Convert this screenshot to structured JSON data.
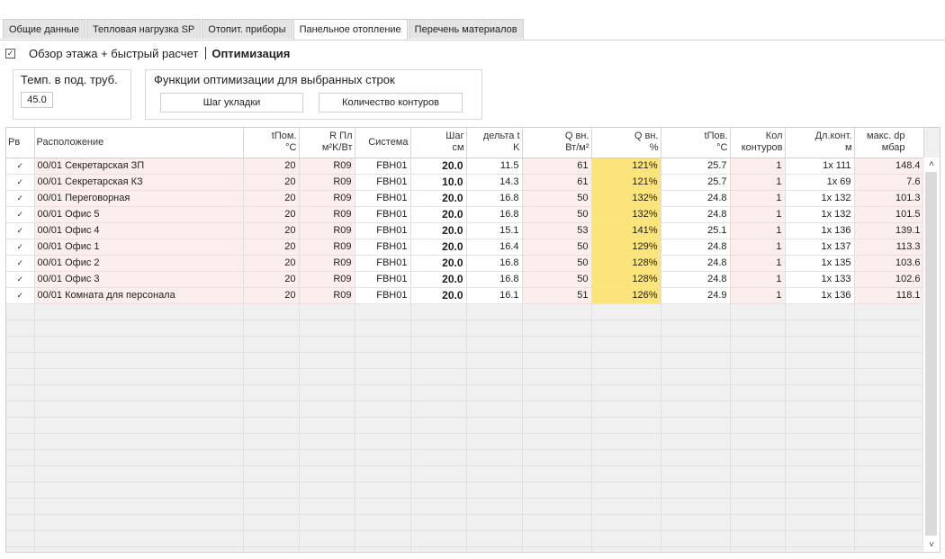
{
  "tabs": [
    {
      "label": "Общие данные",
      "active": false
    },
    {
      "label": "Тепловая нагрузка SP",
      "active": false
    },
    {
      "label": "Отопит. приборы",
      "active": false
    },
    {
      "label": "Панельное отопление",
      "active": true
    },
    {
      "label": "Перечень материалов",
      "active": false
    }
  ],
  "options": {
    "checkbox_checked": true,
    "overview_label": "Обзор этажа + быстрый расчет",
    "section_title": "Оптимизация"
  },
  "temp_group": {
    "title": "Темп. в под. труб.",
    "value": "45.0"
  },
  "opt_group": {
    "title": "Функции оптимизации для выбранных строк",
    "step_button": "Шаг укладки",
    "circuits_button": "Количество контуров"
  },
  "table": {
    "headers": [
      {
        "l1": "Рв",
        "l2": ""
      },
      {
        "l1": "Расположение",
        "l2": ""
      },
      {
        "l1": "tПом.",
        "l2": "°C"
      },
      {
        "l1": "R Пл",
        "l2": "м²K/Вт"
      },
      {
        "l1": "Система",
        "l2": ""
      },
      {
        "l1": "Шаг",
        "l2": "см"
      },
      {
        "l1": "дельта t",
        "l2": "K"
      },
      {
        "l1": "Q вн.",
        "l2": "Вт/м²"
      },
      {
        "l1": "Q вн.",
        "l2": "%"
      },
      {
        "l1": "tПов.",
        "l2": "°C"
      },
      {
        "l1": "Кол",
        "l2": "контуров"
      },
      {
        "l1": "Дл.конт.",
        "l2": "м"
      },
      {
        "l1": "макс. dp",
        "l2": "мбар"
      }
    ],
    "rows": [
      {
        "rv": "✓",
        "loc": "00/01 Секретарская ЗП",
        "t": "20",
        "r": "R09",
        "sys": "FBH01",
        "step": "20.0",
        "dt": "11.5",
        "q": "61",
        "qp": "121%",
        "tp": "25.7",
        "cnt": "1",
        "len": "1x 111",
        "dp": "148.4"
      },
      {
        "rv": "✓",
        "loc": "00/01 Секретарская КЗ",
        "t": "20",
        "r": "R09",
        "sys": "FBH01",
        "step": "10.0",
        "dt": "14.3",
        "q": "61",
        "qp": "121%",
        "tp": "25.7",
        "cnt": "1",
        "len": "1x 69",
        "dp": "7.6"
      },
      {
        "rv": "✓",
        "loc": "00/01 Переговорная",
        "t": "20",
        "r": "R09",
        "sys": "FBH01",
        "step": "20.0",
        "dt": "16.8",
        "q": "50",
        "qp": "132%",
        "tp": "24.8",
        "cnt": "1",
        "len": "1x 132",
        "dp": "101.3"
      },
      {
        "rv": "✓",
        "loc": "00/01 Офис 5",
        "t": "20",
        "r": "R09",
        "sys": "FBH01",
        "step": "20.0",
        "dt": "16.8",
        "q": "50",
        "qp": "132%",
        "tp": "24.8",
        "cnt": "1",
        "len": "1x 132",
        "dp": "101.5"
      },
      {
        "rv": "✓",
        "loc": "00/01 Офис 4",
        "t": "20",
        "r": "R09",
        "sys": "FBH01",
        "step": "20.0",
        "dt": "15.1",
        "q": "53",
        "qp": "141%",
        "tp": "25.1",
        "cnt": "1",
        "len": "1x 136",
        "dp": "139.1"
      },
      {
        "rv": "✓",
        "loc": "00/01 Офис 1",
        "t": "20",
        "r": "R09",
        "sys": "FBH01",
        "step": "20.0",
        "dt": "16.4",
        "q": "50",
        "qp": "129%",
        "tp": "24.8",
        "cnt": "1",
        "len": "1x 137",
        "dp": "113.3"
      },
      {
        "rv": "✓",
        "loc": "00/01 Офис 2",
        "t": "20",
        "r": "R09",
        "sys": "FBH01",
        "step": "20.0",
        "dt": "16.8",
        "q": "50",
        "qp": "128%",
        "tp": "24.8",
        "cnt": "1",
        "len": "1x 135",
        "dp": "103.6"
      },
      {
        "rv": "✓",
        "loc": "00/01 Офис 3",
        "t": "20",
        "r": "R09",
        "sys": "FBH01",
        "step": "20.0",
        "dt": "16.8",
        "q": "50",
        "qp": "128%",
        "tp": "24.8",
        "cnt": "1",
        "len": "1x 133",
        "dp": "102.6"
      },
      {
        "rv": "✓",
        "loc": "00/01 Комната для персонала",
        "t": "20",
        "r": "R09",
        "sys": "FBH01",
        "step": "20.0",
        "dt": "16.1",
        "q": "51",
        "qp": "126%",
        "tp": "24.9",
        "cnt": "1",
        "len": "1x 136",
        "dp": "118.1"
      }
    ]
  },
  "colors": {
    "row_pink": "#fdeeee",
    "highlight_yellow": "#fbe47b"
  },
  "icons": {
    "checkbox": "check-icon",
    "row_marker": "chevron-down-icon",
    "scroll_up": "chevron-up-icon",
    "scroll_down": "chevron-down-icon"
  }
}
